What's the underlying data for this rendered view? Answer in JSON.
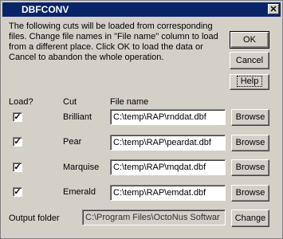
{
  "window": {
    "title": "DBFCONV",
    "close_glyph": "✕"
  },
  "description": "The following cuts will be loaded from corresponding files. Change file names in \"File name\" column to load from a different place. Click OK to load the data or Cancel to abandon the whole operation.",
  "buttons": {
    "ok": "OK",
    "cancel": "Cancel",
    "help": "Help"
  },
  "columns": {
    "load": "Load?",
    "cut": "Cut",
    "file": "File name"
  },
  "rows": [
    {
      "checked": true,
      "cut": "Brilliant",
      "file": "C:\\temp\\RAP\\rnddat.dbf",
      "browse": "Browse"
    },
    {
      "checked": true,
      "cut": "Pear",
      "file": "C:\\temp\\RAP\\peardat.dbf",
      "browse": "Browse"
    },
    {
      "checked": true,
      "cut": "Marquise",
      "file": "C:\\temp\\RAP\\mqdat.dbf",
      "browse": "Browse"
    },
    {
      "checked": true,
      "cut": "Emerald",
      "file": "C:\\temp\\RAP\\emdat.dbf",
      "browse": "Browse"
    }
  ],
  "output": {
    "label": "Output folder",
    "value": "C:\\Program Files\\OctoNus Softwar",
    "change": "Change"
  },
  "check_glyph": "✓"
}
